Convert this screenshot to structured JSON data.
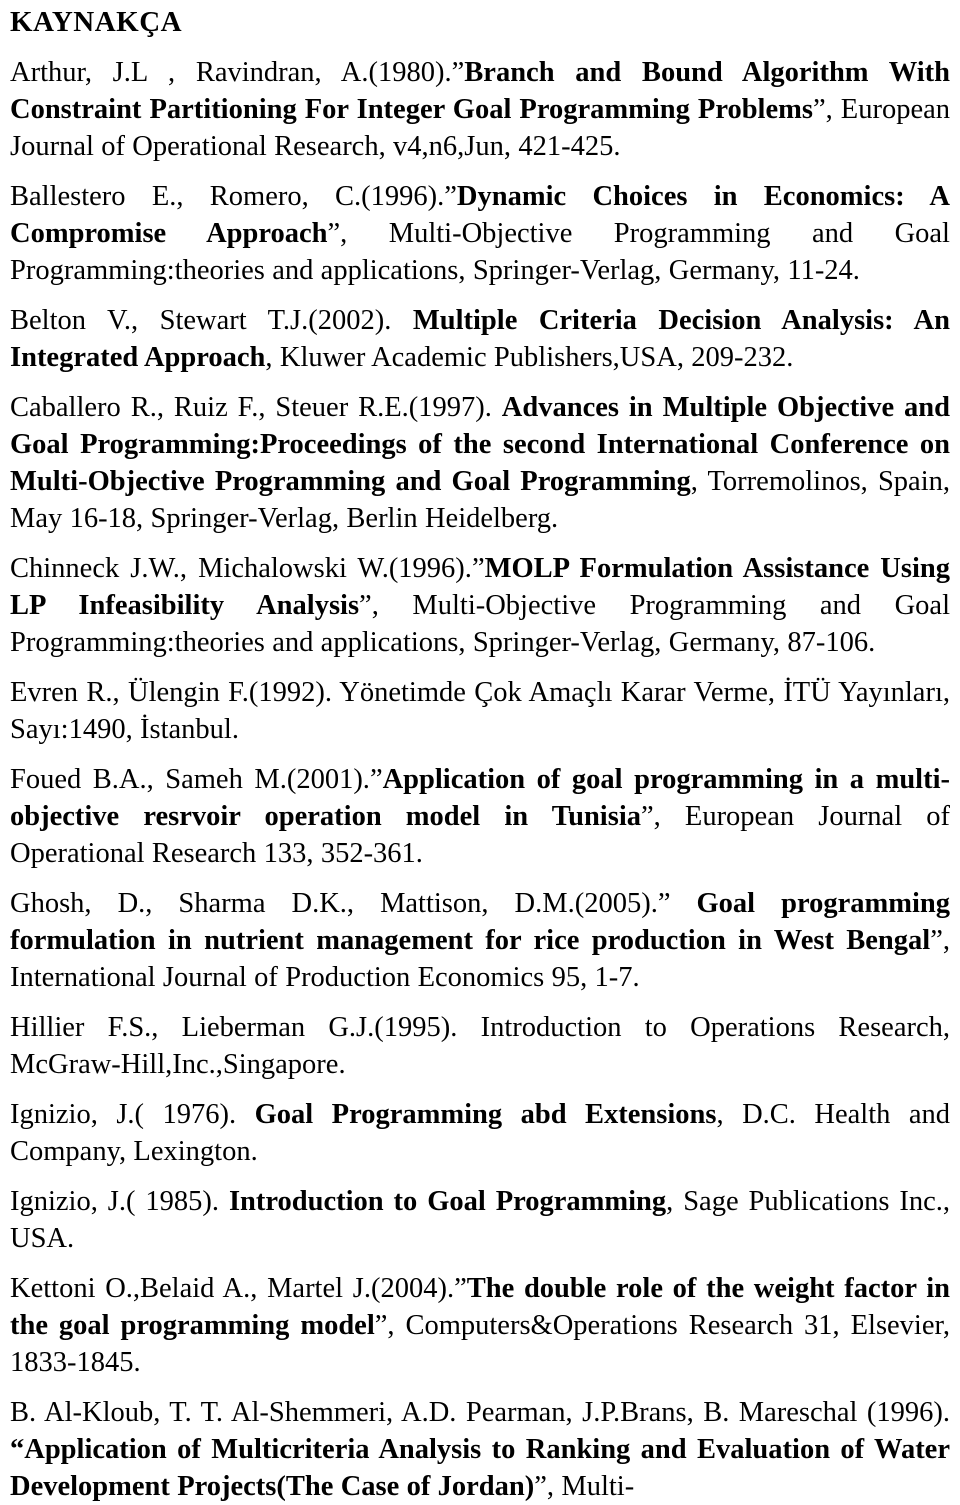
{
  "document": {
    "title": "KAYNAKÇA",
    "language": "tr",
    "references": [
      {
        "id": "ref-arthur-1980",
        "authors_year": "Arthur, J.L , Ravindran, A.(1980).",
        "quote_open": "”",
        "title_bold": "Branch and Bound Algorithm With Constraint Partitioning For Integer Goal Programming Problems",
        "quote_close": "”",
        "source": ", European Journal of Operational Research, v4,n6,Jun, 421-425."
      },
      {
        "id": "ref-ballestero-1996",
        "authors_year": "Ballestero E., Romero, C.(1996).",
        "quote_open": "”",
        "title_bold": "Dynamic Choices in Economics: A Compromise Approach",
        "quote_close": "”",
        "source": ", Multi-Objective Programming and Goal Programming:theories and applications, Springer-Verlag, Germany, 11-24."
      },
      {
        "id": "ref-belton-2002",
        "authors_year": "Belton V., Stewart T.J.(2002). ",
        "quote_open": "",
        "title_bold": "Multiple Criteria Decision Analysis: An Integrated Approach",
        "quote_close": "",
        "source": ", Kluwer Academic Publishers,USA, 209-232."
      },
      {
        "id": "ref-caballero-1997",
        "authors_year": "Caballero R., Ruiz F., Steuer R.E.(1997). ",
        "quote_open": "",
        "title_bold": "Advances in Multiple Objective and Goal Programming:Proceedings of the second International Conference on Multi-Objective Programming and Goal Programming",
        "quote_close": "",
        "source": ", Torremolinos, Spain, May 16-18, Springer-Verlag, Berlin Heidelberg."
      },
      {
        "id": "ref-chinneck-1996",
        "authors_year": "Chinneck J.W., Michalowski W.(1996).",
        "quote_open": "”",
        "title_bold": "MOLP Formulation Assistance Using LP Infeasibility Analysis",
        "quote_close": "”",
        "source": ", Multi-Objective Programming and Goal Programming:theories and applications, Springer-Verlag, Germany, 87-106."
      },
      {
        "id": "ref-evren-1992",
        "authors_year": "Evren R., Ülengin F.(1992). ",
        "quote_open": "",
        "title_bold": "",
        "quote_close": "",
        "source": "Yönetimde Çok Amaçlı Karar Verme, İTÜ Yayınları, Sayı:1490, İstanbul."
      },
      {
        "id": "ref-foued-2001",
        "authors_year": "Foued B.A., Sameh M.(2001).",
        "quote_open": "”",
        "title_bold": "Application of goal programming in a multi-objective resrvoir operation model in Tunisia",
        "quote_close": "”",
        "source": ", European Journal of Operational Research 133, 352-361."
      },
      {
        "id": "ref-ghosh-2005",
        "authors_year": "Ghosh, D., Sharma D.K., Mattison, D.M.(2005).",
        "quote_open": "” ",
        "title_bold": "Goal programming formulation in nutrient management for rice production in West Bengal",
        "quote_close": "”",
        "source": ", International Journal of Production Economics 95, 1-7."
      },
      {
        "id": "ref-hillier-1995",
        "authors_year": "Hillier F.S., Lieberman G.J.(1995). ",
        "quote_open": "",
        "title_bold": "",
        "quote_close": "",
        "source": "Introduction to Operations Research, McGraw-Hill,Inc.,Singapore."
      },
      {
        "id": "ref-ignizio-1976",
        "authors_year": "Ignizio, J.( 1976). ",
        "quote_open": "",
        "title_bold": "Goal  Programming abd Extensions",
        "quote_close": "",
        "source": ", D.C. Health and Company, Lexington."
      },
      {
        "id": "ref-ignizio-1985",
        "authors_year": "Ignizio, J.( 1985). ",
        "quote_open": "",
        "title_bold": "Introduction to Goal  Programming",
        "quote_close": "",
        "source": ", Sage Publications Inc., USA."
      },
      {
        "id": "ref-kettoni-2004",
        "authors_year": "Kettoni O.,Belaid A., Martel J.(2004).",
        "quote_open": "”",
        "title_bold": "The double role of the weight factor in the goal programming model",
        "quote_close": "”",
        "source": ", Computers&Operations Research 31, Elsevier, 1833-1845."
      },
      {
        "id": "ref-alkloub-1996",
        "authors_year": "B. Al-Kloub, T. T. Al-Shemmeri, A.D. Pearman, J.P.Brans, B. Mareschal (1996). ",
        "quote_open": "“",
        "title_bold": "Application of Multicriteria Analysis to Ranking and Evaluation of Water Development Projects(The Case of Jordan)",
        "quote_close": "”",
        "source": ", Multi-"
      }
    ]
  }
}
